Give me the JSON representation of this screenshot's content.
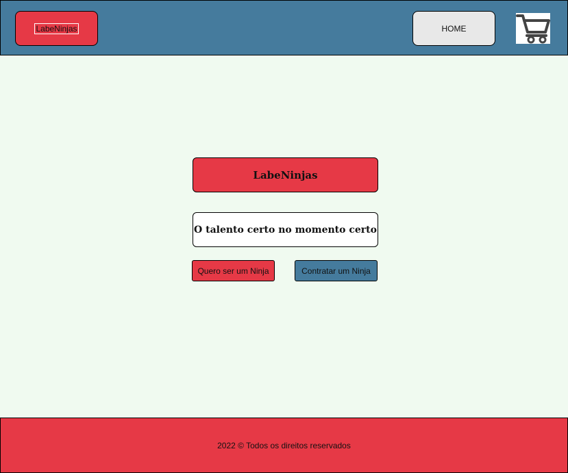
{
  "header": {
    "logo_label": "LabeNinjas",
    "home_label": "HOME",
    "cart_icon": "shopping-cart-icon"
  },
  "hero": {
    "brand": "LabeNinjas",
    "tagline": "O talento certo no momento certo",
    "cta_ninja": "Quero ser um Ninja",
    "cta_hire": "Contratar um Ninja"
  },
  "footer": {
    "copyright": "2022 © Todos os direitos reservados"
  },
  "colors": {
    "header_bg": "#457b9d",
    "accent_red": "#e63946",
    "page_bg": "#f0faf0",
    "home_bg": "#e8e8e8"
  }
}
